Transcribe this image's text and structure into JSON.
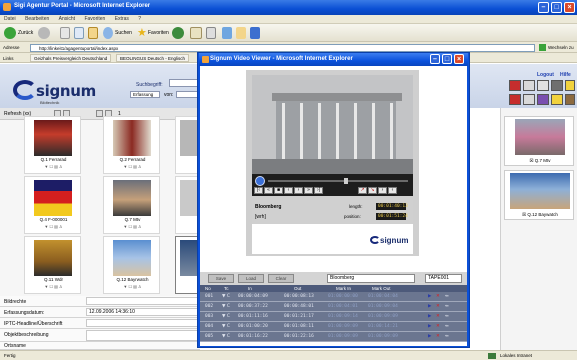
{
  "ie": {
    "title": "Sigi Agentur Portal - Microsoft Internet Explorer",
    "menu": [
      "Datei",
      "Bearbeiten",
      "Ansicht",
      "Favoriten",
      "Extras",
      "?"
    ],
    "back": "Zurück",
    "search": "Suchen",
    "favorites": "Favoriten",
    "address_label": "Adresse",
    "address": "http://linkeit1/agagentuportal/index.aspx",
    "go": "Wechseln zu",
    "links_label": "Links",
    "link1": "Geizhals Preisvergleich Deutschland",
    "link2": "BEOLINGUS Deutsch - Englisch"
  },
  "header": {
    "logo": "signum",
    "logo_sub": "Bildtechnik",
    "search_label": "Suchbegriff:",
    "search_value": "",
    "date_select": "Erfassung",
    "von_label": "von:",
    "logout": "Logout",
    "help": "Hilfe"
  },
  "left": {
    "refresh": "Refresh (xx)",
    "page": "1",
    "thumbs": [
      {
        "caption": "Q.1 Ferrarad"
      },
      {
        "caption": "Q.2 Ferrarad"
      },
      {
        "caption": "Q.4 F-000001"
      },
      {
        "caption": "Q.7 Mtv"
      },
      {
        "caption": "Q.11 Wdr"
      },
      {
        "caption": "Q.12 Bayrwatch"
      }
    ],
    "meta": [
      {
        "label": "Bildrechte",
        "value": ""
      },
      {
        "label": "Erfassungsdatum:",
        "value": "12.09.2006 14:36:10"
      },
      {
        "label": "IPTC-Headline/Überschrift",
        "value": ""
      },
      {
        "label": "Objektbeschreibung",
        "value": ""
      },
      {
        "label": "Ortsname",
        "value": ""
      }
    ]
  },
  "right": {
    "thumbs": [
      {
        "caption": "Q.7 Mtv"
      },
      {
        "caption": "Q.12 Baywatch"
      }
    ]
  },
  "viewer": {
    "title": "Signum Video Viewer - Microsoft Internet Explorer",
    "clip_name": "Bloomberg",
    "clip_note": "[wrh]",
    "length_label": "length:",
    "length_value": "00:01:40:13",
    "position_label": "position:",
    "position_value": "00:01:51:24",
    "logo": "signum",
    "buttons": {
      "save": "Save",
      "load": "Load",
      "clear": "Clear"
    },
    "name_value": "Bloomberg",
    "tape_value": "TAPE001",
    "columns": [
      "No",
      "Tc",
      "In",
      "Out",
      "Mark In",
      "Mark Out"
    ],
    "rows": [
      {
        "no": "001",
        "tin": "00:00:04:09",
        "tout": "00:00:08:13",
        "mi": "01:00:00:00",
        "mo": "01:00:04:04"
      },
      {
        "no": "002",
        "tin": "00:00:37:22",
        "tout": "00:00:48:01",
        "mi": "01:00:04:01",
        "mo": "01:00:09:04"
      },
      {
        "no": "003",
        "tin": "00:01:11:16",
        "tout": "00:01:21:17",
        "mi": "01:00:09:14",
        "mo": "01:00:09:09"
      },
      {
        "no": "004",
        "tin": "00:01:00:20",
        "tout": "00:01:08:11",
        "mi": "01:00:09:09",
        "mo": "01:00:14:21"
      },
      {
        "no": "005",
        "tin": "00:01:16:22",
        "tout": "00:01:22:16",
        "mi": "01:00:09:09",
        "mo": "01:00:09:09"
      }
    ]
  },
  "status": {
    "left": "Fertig",
    "right": "Lokales Intranet"
  }
}
